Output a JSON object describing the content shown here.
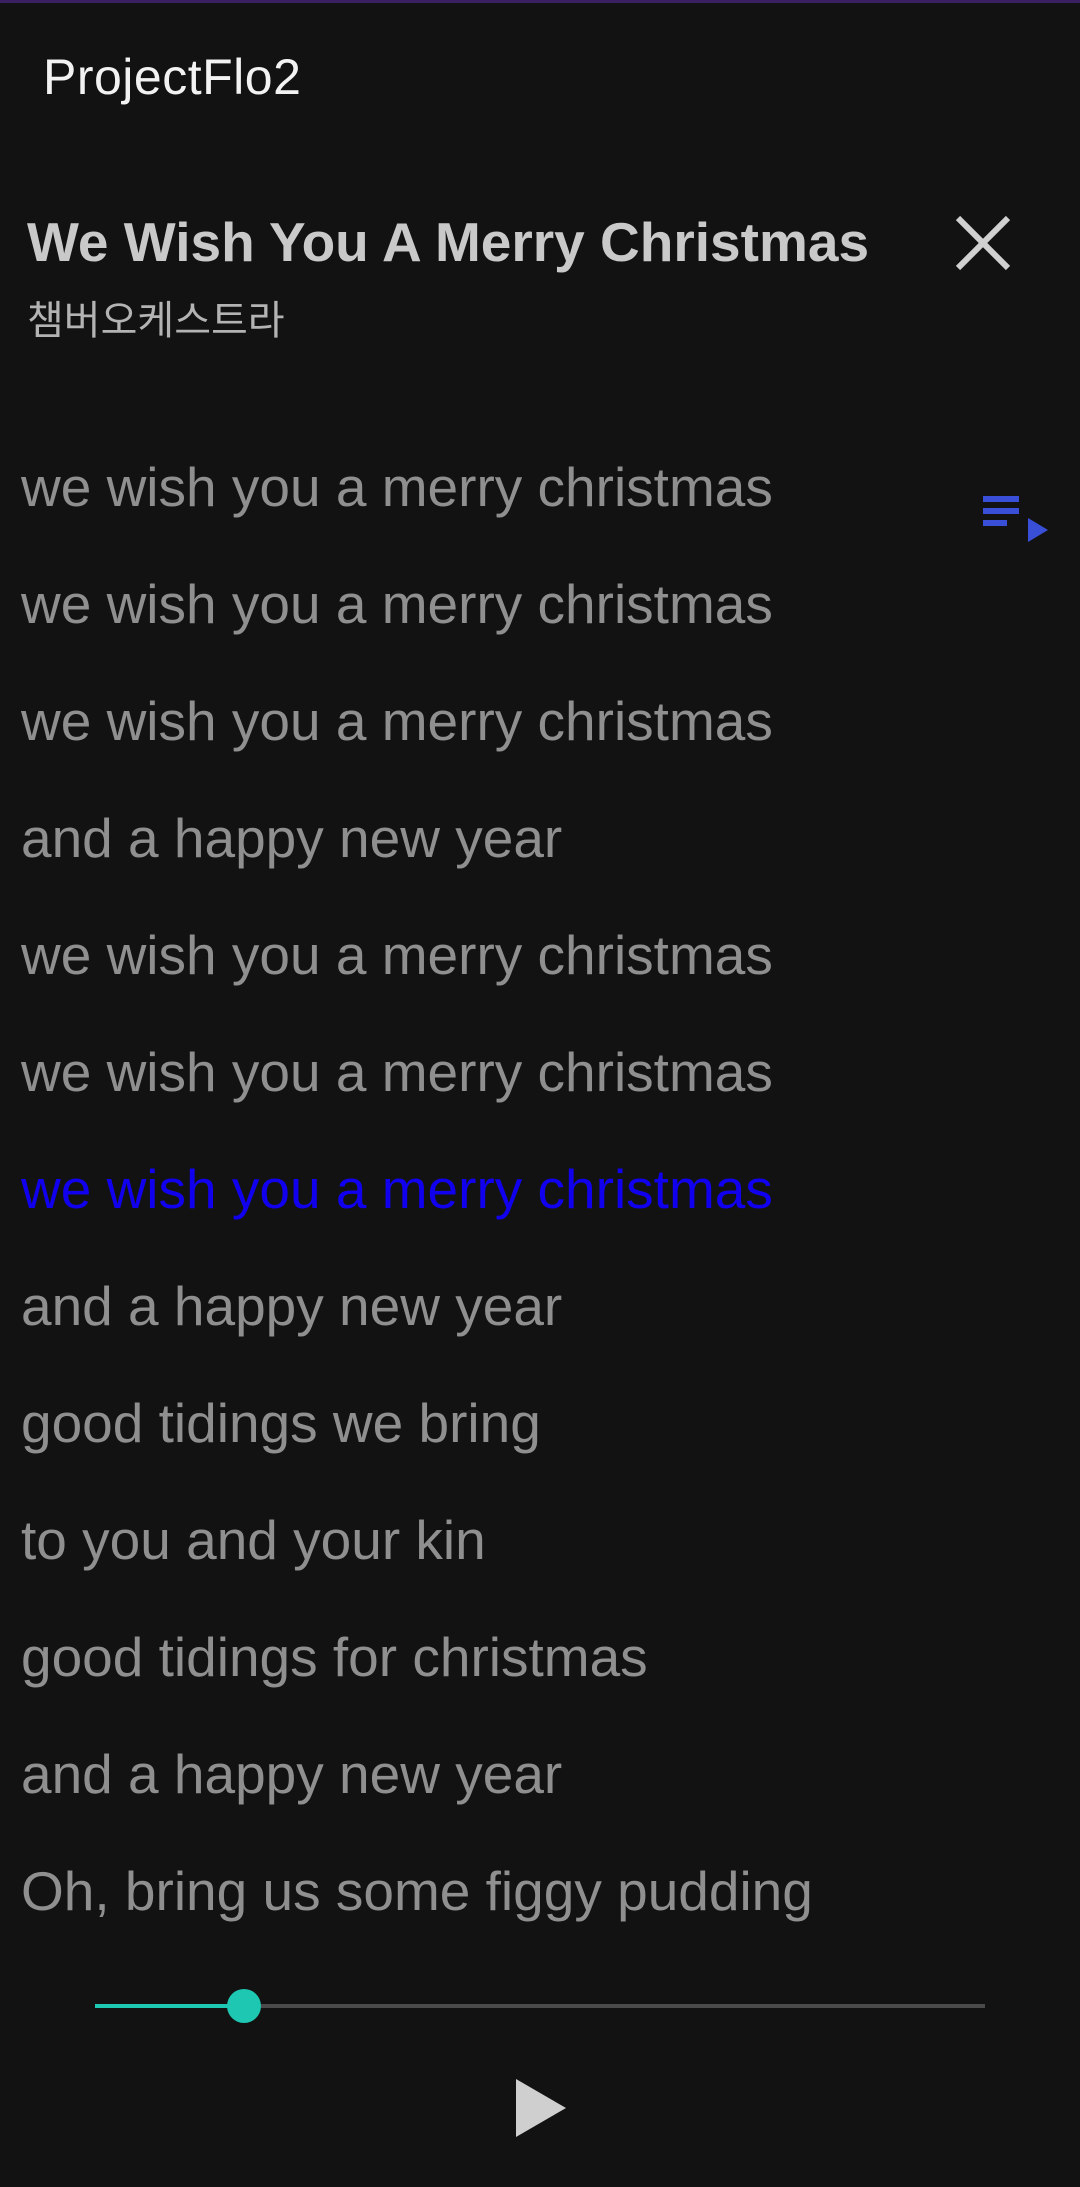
{
  "app": {
    "title": "ProjectFlo2"
  },
  "song": {
    "title": "We Wish You A Merry Christmas",
    "artist": "챔버오케스트라"
  },
  "icons": {
    "close": "close-icon",
    "playlist": "playlist-play-icon",
    "play": "play-icon"
  },
  "colors": {
    "background": "#121212",
    "active_lyric": "#1100ee",
    "inactive_lyric": "#8f8f8f",
    "seek_accent": "#1ec7b1",
    "playlist_icon": "#3a4fd8"
  },
  "lyrics": {
    "active_index": 6,
    "lines": [
      "we wish you a merry christmas",
      "we wish you a merry christmas",
      "we wish you a merry christmas",
      "and a happy new year",
      "we wish you a merry christmas",
      "we wish you a merry christmas",
      "we wish you a merry christmas",
      "and a happy new year",
      "good tidings we bring",
      "to you and your kin",
      "good tidings for christmas",
      "and a happy new year",
      "Oh, bring us some figgy pudding"
    ]
  },
  "player": {
    "progress": 0.167,
    "state": "paused"
  }
}
